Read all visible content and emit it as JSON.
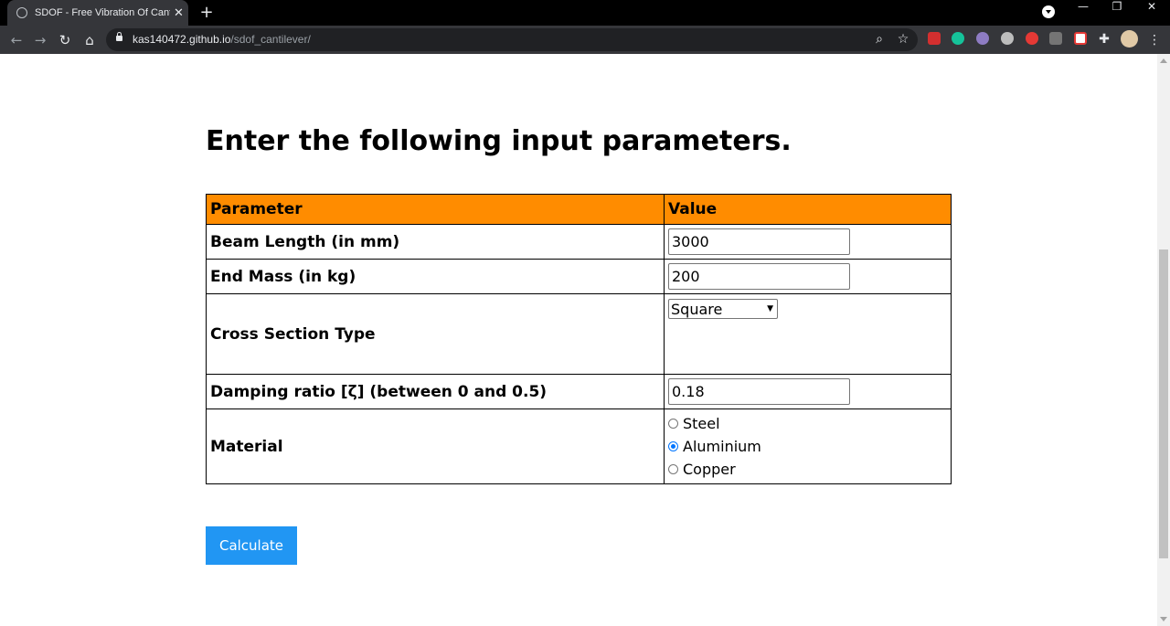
{
  "browser": {
    "tab_title": "SDOF - Free Vibration Of Cantilever",
    "url_host": "kas140472.github.io",
    "url_path": "/sdof_cantilever/"
  },
  "page": {
    "heading": "Enter the following input parameters.",
    "table": {
      "col_parameter": "Parameter",
      "col_value": "Value",
      "beam_length": {
        "label": "Beam Length (in mm)",
        "value": "3000"
      },
      "end_mass": {
        "label": "End Mass (in kg)",
        "value": "200"
      },
      "cross_section": {
        "label": "Cross Section Type",
        "selected": "Square"
      },
      "damping": {
        "label": "Damping ratio [ζ] (between 0 and 0.5)",
        "value": "0.18"
      },
      "material": {
        "label": "Material",
        "options": [
          "Steel",
          "Aluminium",
          "Copper"
        ],
        "selected": "Aluminium"
      }
    },
    "calculate_label": "Calculate"
  },
  "colors": {
    "header_bg": "#ff8c00",
    "button_bg": "#2196f3",
    "radio_checked": "#0075ff"
  }
}
